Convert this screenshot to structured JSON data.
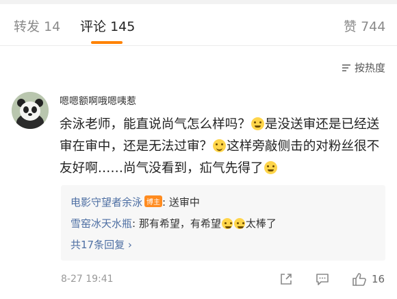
{
  "tabs": [
    {
      "label": "转发",
      "count": "14"
    },
    {
      "label": "评论",
      "count": "145"
    },
    {
      "label": "赞",
      "count": "744"
    }
  ],
  "sort": {
    "label": "按热度"
  },
  "comment": {
    "username": "嗯嗯额啊哦嗯咦惹",
    "segments": [
      "余泳老师，能直说尚气怎么样吗？",
      "是没送审还是已经送审在审中，还是无法过审？",
      "这样旁敲侧击的对粉丝很不友好啊……尚气没看到，疝气先得了"
    ],
    "emojis": [
      "cry-emoji",
      "smile-emoji",
      "cry-emoji"
    ],
    "time": "8-27 19:41",
    "likes": "16"
  },
  "replies": [
    {
      "name": "电影守望者余泳",
      "badge": "博主",
      "text": ": 送审中"
    },
    {
      "name": "雪窑冰天水瓶",
      "text": ": 那有希望，有希望",
      "text_after": "太棒了"
    }
  ],
  "more_replies": "共17条回复 ›",
  "colors": {
    "accent": "#ff8200",
    "link": "#4e6fa3",
    "badge": "#ff8b1f"
  }
}
